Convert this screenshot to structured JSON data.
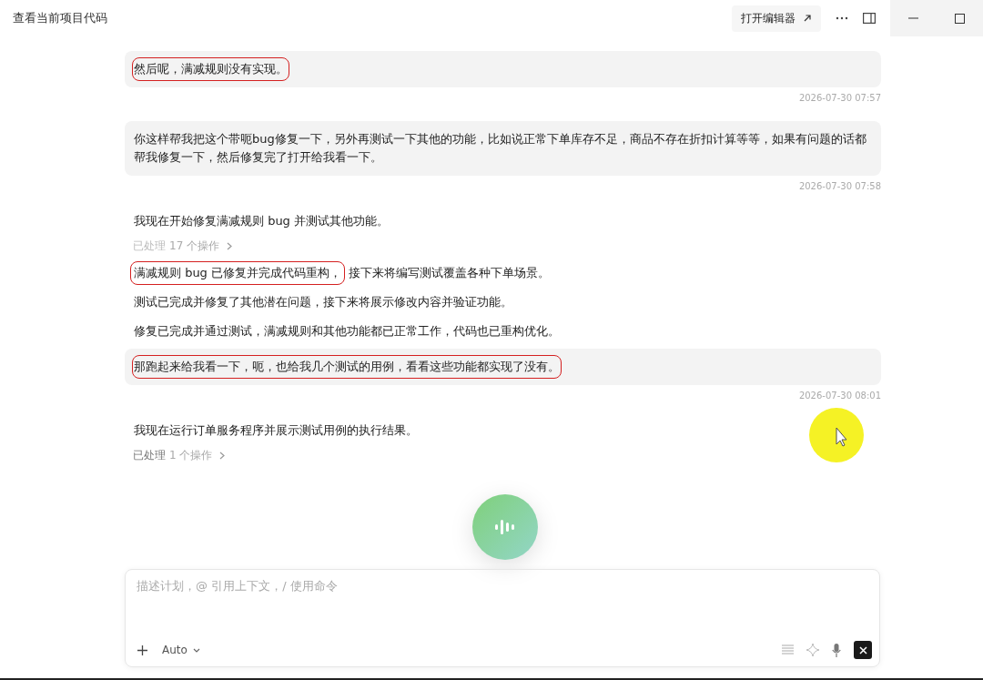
{
  "window": {
    "title": "查看当前项目代码"
  },
  "header": {
    "open_editor": "打开编辑器"
  },
  "messages": [
    {
      "kind": "user",
      "text": "然后呢，满减规则没有实现。",
      "timestamp": "2026-07-30 07:57",
      "highlighted": true
    },
    {
      "kind": "user",
      "text": "你这样帮我把这个带呃bug修复一下，另外再测试一下其他的功能，比如说正常下单库存不足，商品不存在折扣计算等等，如果有问题的话都帮我修复一下，然后修复完了打开给我看一下。",
      "timestamp": "2026-07-30 07:58",
      "highlighted": false
    },
    {
      "kind": "assistant",
      "segments": [
        {
          "text": "我现在开始修复满减规则 bug 并测试其他功能。",
          "highlighted": false
        }
      ]
    },
    {
      "kind": "steps",
      "label": "已处理",
      "count": "17 个操作",
      "faded": true
    },
    {
      "kind": "assistant",
      "segments": [
        {
          "text": "满减规则 bug 已修复并完成代码重构，",
          "highlighted": true
        },
        {
          "text": "接下来将编写测试覆盖各种下单场景。",
          "highlighted": false
        }
      ]
    },
    {
      "kind": "assistant",
      "segments": [
        {
          "text": "测试已完成并修复了其他潜在问题，接下来将展示修改内容并验证功能。",
          "highlighted": false
        }
      ]
    },
    {
      "kind": "assistant",
      "segments": [
        {
          "text": "修复已完成并通过测试，满减规则和其他功能都已正常工作，代码也已重构优化。",
          "highlighted": false
        }
      ]
    },
    {
      "kind": "user",
      "text": "那跑起来给我看一下，呃，也给我几个测试的用例，看看这些功能都实现了没有。",
      "timestamp": "2026-07-30 08:01",
      "highlighted": true
    },
    {
      "kind": "assistant",
      "segments": [
        {
          "text": "我现在运行订单服务程序并展示测试用例的执行结果。",
          "highlighted": false
        }
      ]
    },
    {
      "kind": "steps",
      "label": "已处理",
      "count": "1 个操作",
      "faded": false
    }
  ],
  "composer": {
    "placeholder": "描述计划，@ 引用上下文，/ 使用命令",
    "mode": "Auto"
  }
}
